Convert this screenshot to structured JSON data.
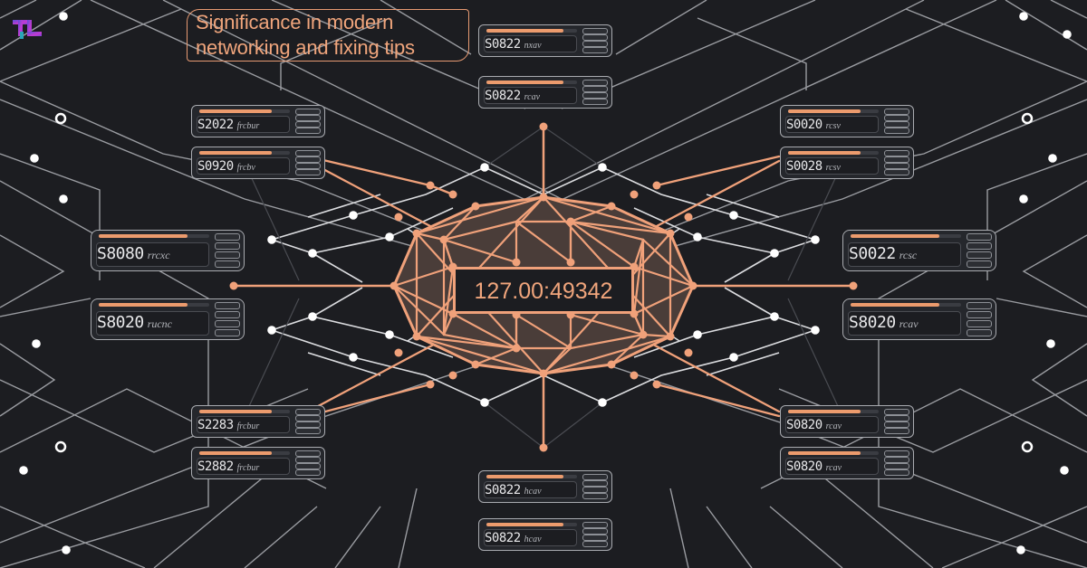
{
  "title": {
    "line1": "Significance in modern",
    "line2": "networking and fixing tips"
  },
  "logo": {
    "label": "TL",
    "colors": [
      "#6a4bd6",
      "#c43ad0",
      "#2aa6b8"
    ]
  },
  "center": {
    "address": "127.00:49342"
  },
  "colors": {
    "background": "#1c1d21",
    "accent": "#f0a17a",
    "node_white": "#ffffff",
    "line_gray": "#9a9ca1"
  },
  "cards": [
    {
      "id": "top-1",
      "code": "S0822",
      "tag": "nxav",
      "fill": 0.85
    },
    {
      "id": "top-2",
      "code": "S0822",
      "tag": "rcav",
      "fill": 0.85
    },
    {
      "id": "upper-left-1",
      "code": "S2022",
      "tag": "frcbur",
      "fill": 0.8
    },
    {
      "id": "upper-left-2",
      "code": "S0920",
      "tag": "frcbv",
      "fill": 0.8
    },
    {
      "id": "mid-left-1",
      "code": "S8080",
      "tag": "rrcxc",
      "fill": 0.8
    },
    {
      "id": "mid-left-2",
      "code": "S8020",
      "tag": "rucnc",
      "fill": 0.8
    },
    {
      "id": "lower-left-1",
      "code": "S2283",
      "tag": "frcbur",
      "fill": 0.8
    },
    {
      "id": "lower-left-2",
      "code": "S2882",
      "tag": "frcbur",
      "fill": 0.8
    },
    {
      "id": "bottom-1",
      "code": "S0822",
      "tag": "hcav",
      "fill": 0.85
    },
    {
      "id": "bottom-2",
      "code": "S0822",
      "tag": "hcav",
      "fill": 0.85
    },
    {
      "id": "upper-right-1",
      "code": "S0020",
      "tag": "rcsv",
      "fill": 0.8
    },
    {
      "id": "upper-right-2",
      "code": "S0028",
      "tag": "rcsv",
      "fill": 0.8
    },
    {
      "id": "mid-right-1",
      "code": "S0022",
      "tag": "rcsc",
      "fill": 0.8
    },
    {
      "id": "mid-right-2",
      "code": "S8020",
      "tag": "rcav",
      "fill": 0.8
    },
    {
      "id": "lower-right-1",
      "code": "S0820",
      "tag": "rcav",
      "fill": 0.8
    },
    {
      "id": "lower-right-2",
      "code": "S0820",
      "tag": "rcav",
      "fill": 0.8
    }
  ]
}
